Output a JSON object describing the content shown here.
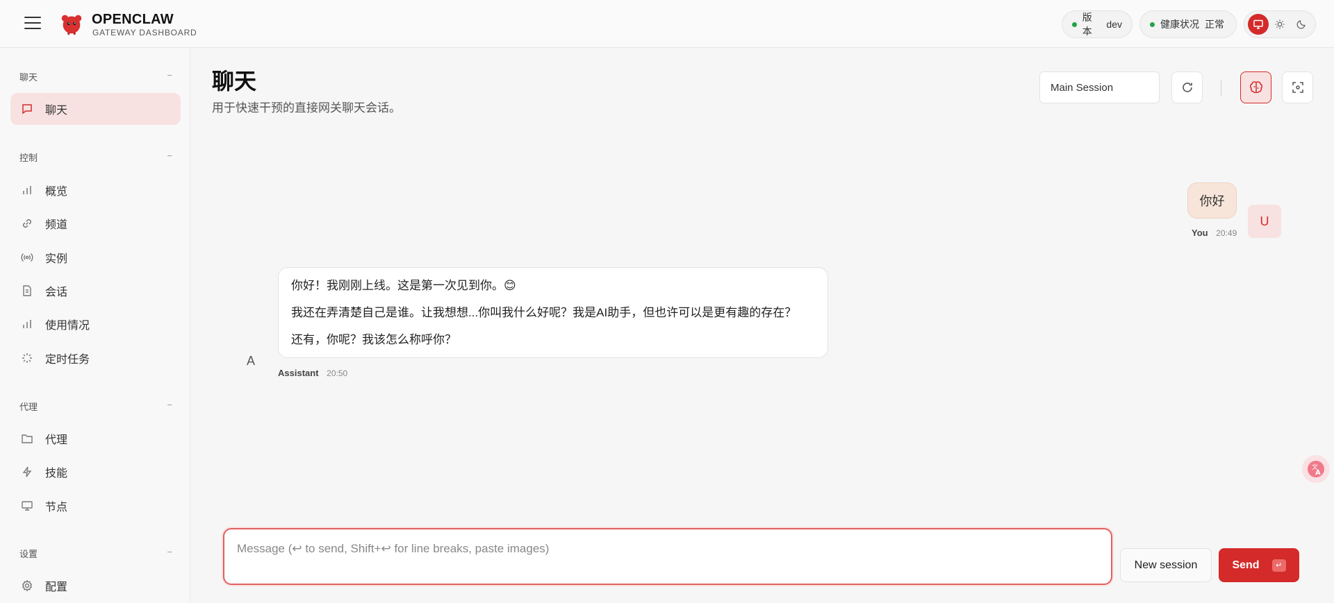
{
  "brand": {
    "title": "OPENCLAW",
    "subtitle": "GATEWAY DASHBOARD"
  },
  "header": {
    "version": {
      "label": "版本",
      "value": "dev",
      "status_color": "#22a34a"
    },
    "health": {
      "label": "健康状况",
      "value": "正常",
      "status_color": "#22a34a"
    },
    "theme": {
      "active": "system",
      "options": [
        "system-icon",
        "sun-icon",
        "moon-icon"
      ]
    }
  },
  "sidebar": {
    "sections": [
      {
        "title": "聊天",
        "items": [
          {
            "label": "聊天",
            "icon": "chat-icon",
            "active": true
          }
        ]
      },
      {
        "title": "控制",
        "items": [
          {
            "label": "概览",
            "icon": "bar-chart-icon"
          },
          {
            "label": "频道",
            "icon": "link-icon"
          },
          {
            "label": "实例",
            "icon": "broadcast-icon"
          },
          {
            "label": "会话",
            "icon": "document-icon"
          },
          {
            "label": "使用情况",
            "icon": "bar-chart-icon"
          },
          {
            "label": "定时任务",
            "icon": "loader-icon"
          }
        ]
      },
      {
        "title": "代理",
        "items": [
          {
            "label": "代理",
            "icon": "folder-icon"
          },
          {
            "label": "技能",
            "icon": "lightning-icon"
          },
          {
            "label": "节点",
            "icon": "monitor-icon"
          }
        ]
      },
      {
        "title": "设置",
        "items": [
          {
            "label": "配置",
            "icon": "gear-icon"
          }
        ]
      }
    ],
    "collapse_symbol": "−"
  },
  "main": {
    "title": "聊天",
    "subtitle": "用于快速干预的直接网关聊天会话。",
    "session": "Main Session"
  },
  "messages": [
    {
      "role": "user",
      "author": "You",
      "time": "20:49",
      "avatar": "U",
      "text": [
        "你好"
      ]
    },
    {
      "role": "assistant",
      "author": "Assistant",
      "time": "20:50",
      "avatar": "A",
      "text": [
        "你好！我刚刚上线。这是第一次见到你。😊",
        "我还在弄清楚自己是谁。让我想想...你叫我什么好呢？我是AI助手，但也许可以是更有趣的存在？",
        "还有，你呢？我该怎么称呼你？"
      ]
    }
  ],
  "composer": {
    "placeholder": "Message (↩ to send, Shift+↩ for line breaks, paste images)",
    "new_session_label": "New session",
    "send_label": "Send",
    "send_key": "↵"
  },
  "colors": {
    "accent": "#d42a2a",
    "accent_soft": "#f8e2e1"
  }
}
